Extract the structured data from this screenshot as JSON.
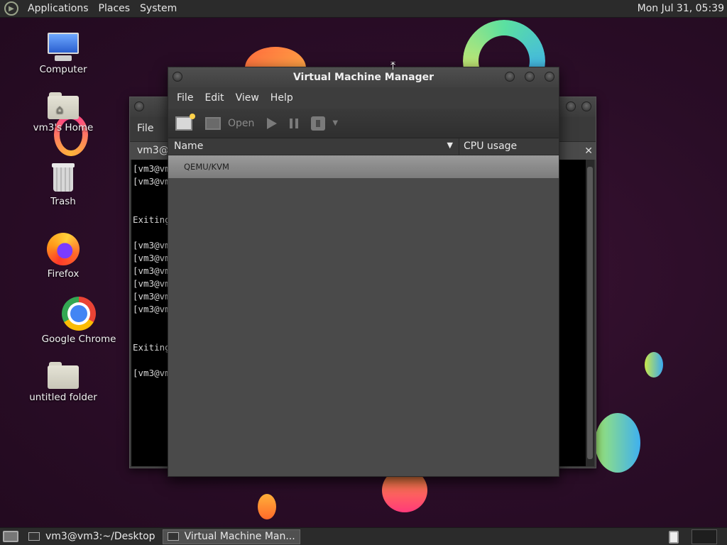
{
  "top_panel": {
    "menus": [
      "Applications",
      "Places",
      "System"
    ],
    "clock": "Mon Jul 31, 05:39"
  },
  "desktop": {
    "icons": [
      {
        "label": "Computer",
        "icon": "computer-icon"
      },
      {
        "label": "vm3's Home",
        "icon": "home-folder-icon"
      },
      {
        "label": "Trash",
        "icon": "trash-icon"
      },
      {
        "label": "Firefox",
        "icon": "firefox-icon"
      },
      {
        "label": "Google Chrome",
        "icon": "chrome-icon"
      },
      {
        "label": "untitled folder",
        "icon": "folder-icon"
      }
    ]
  },
  "terminal": {
    "menu_file": "File",
    "tab_label": "vm3@v",
    "lines": [
      "[vm3@vm",
      "[vm3@vm",
      "",
      "",
      "Exiting",
      "",
      "[vm3@vm",
      "[vm3@vm",
      "[vm3@vm",
      "[vm3@vm",
      "[vm3@vm",
      "[vm3@vm",
      "",
      "",
      "Exiting",
      "",
      "[vm3@vm"
    ]
  },
  "vmm": {
    "title": "Virtual Machine Manager",
    "menus": [
      "File",
      "Edit",
      "View",
      "Help"
    ],
    "toolbar": {
      "open_label": "Open"
    },
    "columns": {
      "name": "Name",
      "cpu": "CPU usage"
    },
    "rows": [
      {
        "name": "QEMU/KVM"
      }
    ]
  },
  "taskbar": {
    "tasks": [
      {
        "label": "vm3@vm3:~/Desktop",
        "active": false
      },
      {
        "label": "Virtual Machine Man...",
        "active": true
      }
    ]
  }
}
